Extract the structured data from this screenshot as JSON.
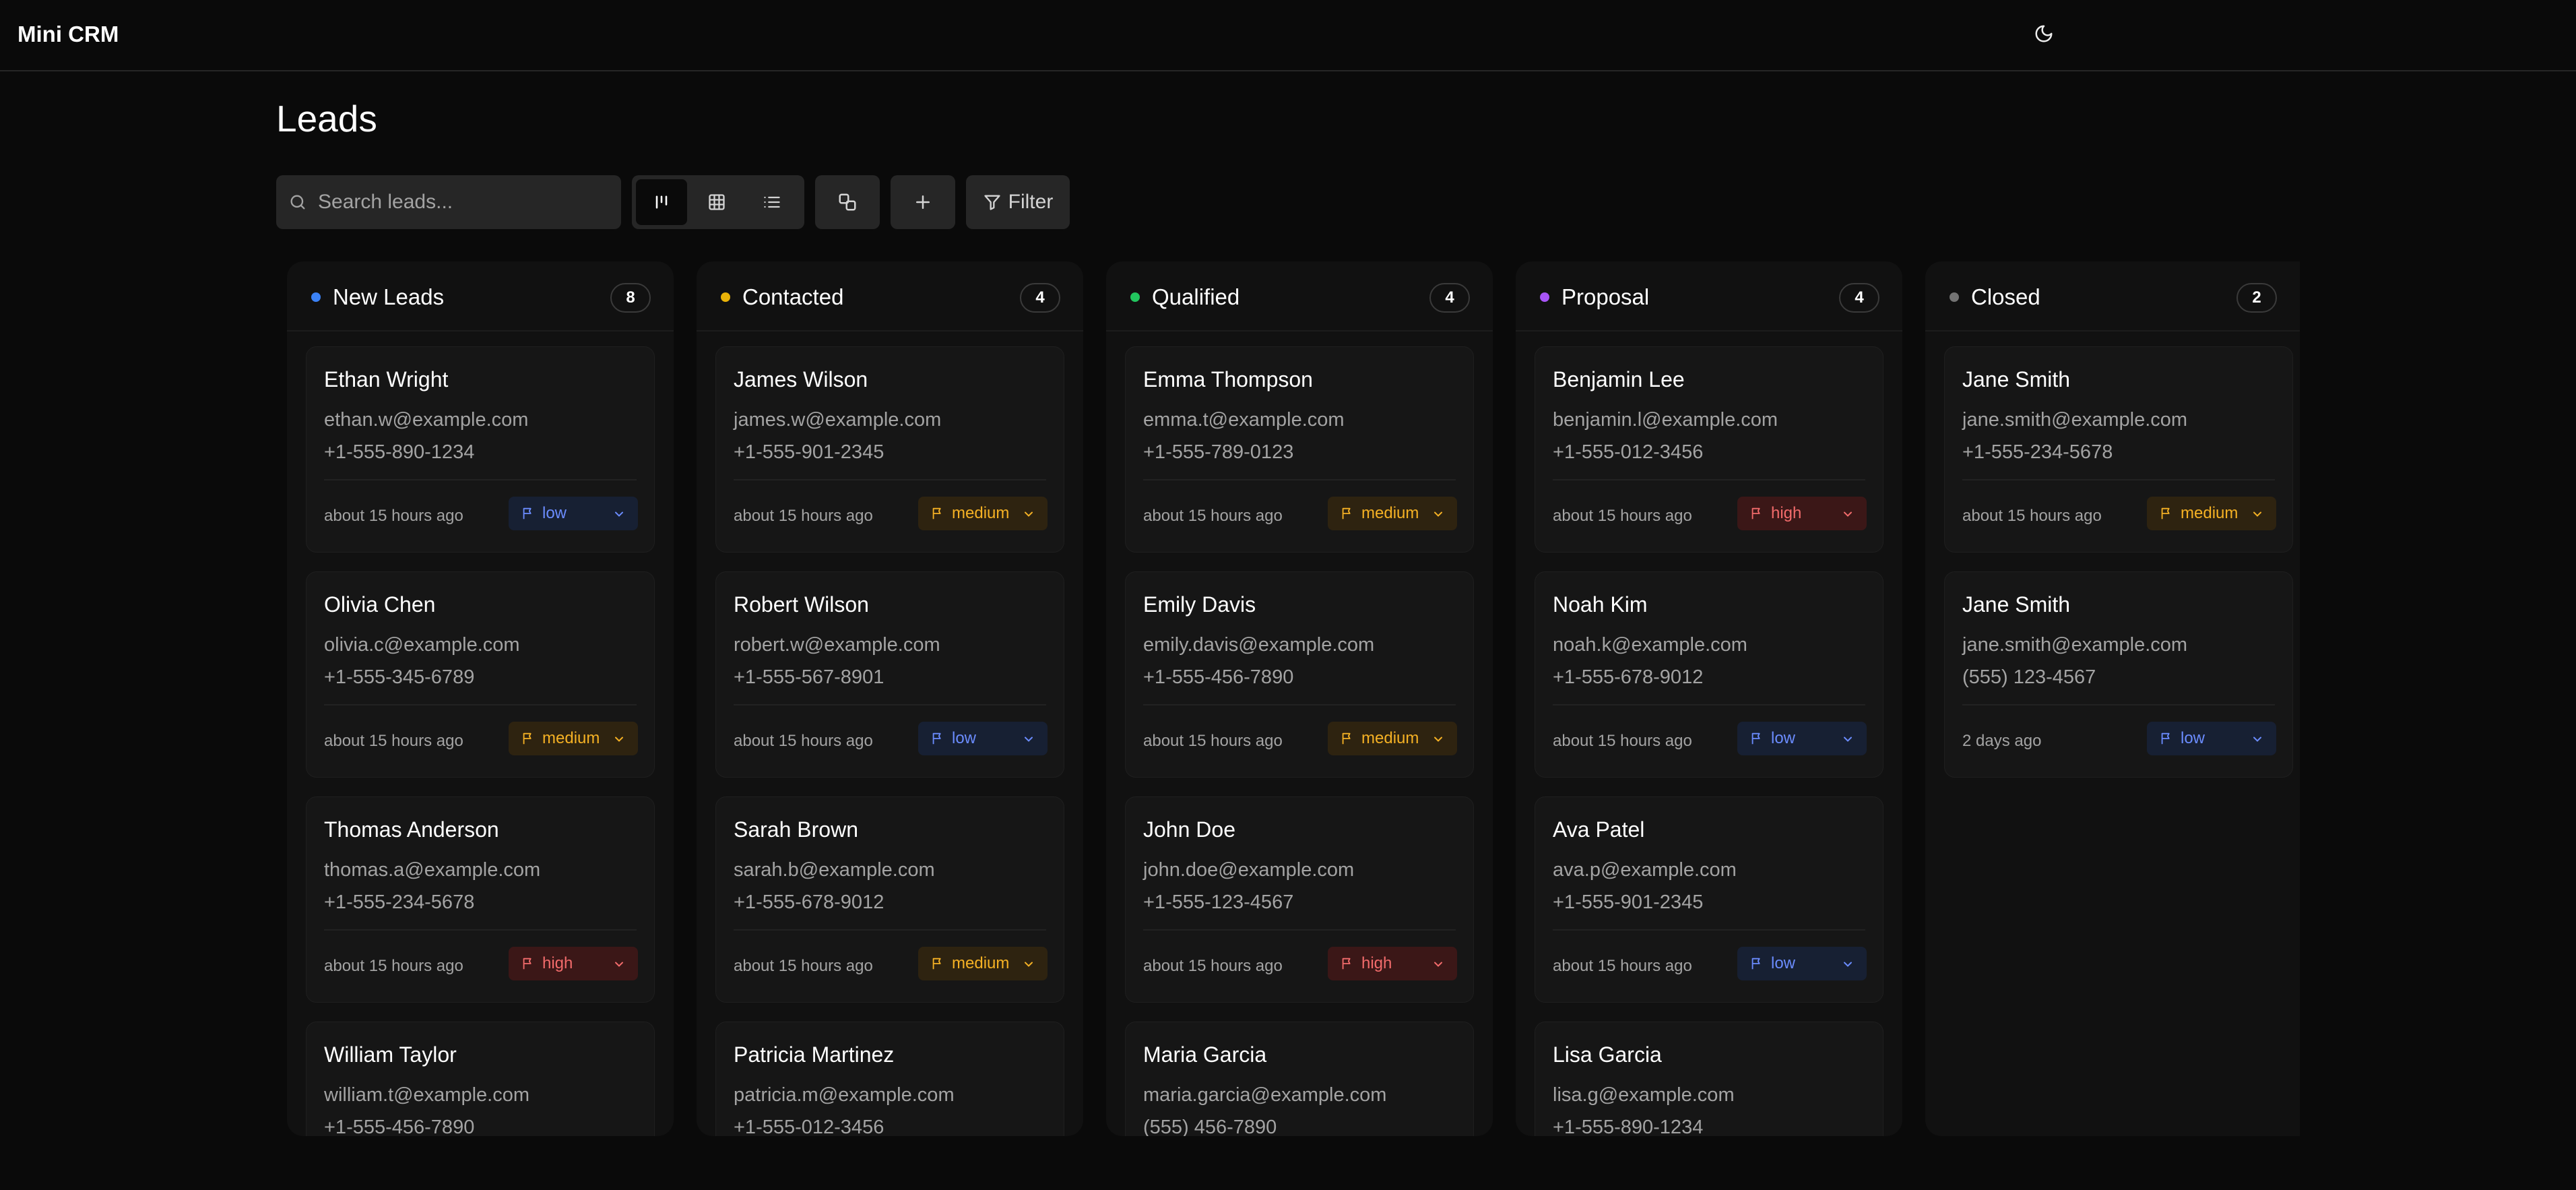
{
  "app": {
    "title": "Mini CRM"
  },
  "page": {
    "title": "Leads"
  },
  "search": {
    "placeholder": "Search leads..."
  },
  "toolbar": {
    "filter_label": "Filter"
  },
  "columns": [
    {
      "title": "New Leads",
      "count": "8",
      "color": "#3b82f6",
      "cards": [
        {
          "name": "Ethan Wright",
          "email": "ethan.w@example.com",
          "phone": "+1-555-890-1234",
          "time": "about 15 hours ago",
          "priority": "low"
        },
        {
          "name": "Olivia Chen",
          "email": "olivia.c@example.com",
          "phone": "+1-555-345-6789",
          "time": "about 15 hours ago",
          "priority": "medium"
        },
        {
          "name": "Thomas Anderson",
          "email": "thomas.a@example.com",
          "phone": "+1-555-234-5678",
          "time": "about 15 hours ago",
          "priority": "high"
        },
        {
          "name": "William Taylor",
          "email": "william.t@example.com",
          "phone": "+1-555-456-7890",
          "time": "",
          "priority": ""
        }
      ]
    },
    {
      "title": "Contacted",
      "count": "4",
      "color": "#eab308",
      "cards": [
        {
          "name": "James Wilson",
          "email": "james.w@example.com",
          "phone": "+1-555-901-2345",
          "time": "about 15 hours ago",
          "priority": "medium"
        },
        {
          "name": "Robert Wilson",
          "email": "robert.w@example.com",
          "phone": "+1-555-567-8901",
          "time": "about 15 hours ago",
          "priority": "low"
        },
        {
          "name": "Sarah Brown",
          "email": "sarah.b@example.com",
          "phone": "+1-555-678-9012",
          "time": "about 15 hours ago",
          "priority": "medium"
        },
        {
          "name": "Patricia Martinez",
          "email": "patricia.m@example.com",
          "phone": "+1-555-012-3456",
          "time": "",
          "priority": ""
        }
      ]
    },
    {
      "title": "Qualified",
      "count": "4",
      "color": "#22c55e",
      "cards": [
        {
          "name": "Emma Thompson",
          "email": "emma.t@example.com",
          "phone": "+1-555-789-0123",
          "time": "about 15 hours ago",
          "priority": "medium"
        },
        {
          "name": "Emily Davis",
          "email": "emily.davis@example.com",
          "phone": "+1-555-456-7890",
          "time": "about 15 hours ago",
          "priority": "medium"
        },
        {
          "name": "John Doe",
          "email": "john.doe@example.com",
          "phone": "+1-555-123-4567",
          "time": "about 15 hours ago",
          "priority": "high"
        },
        {
          "name": "Maria Garcia",
          "email": "maria.garcia@example.com",
          "phone": "(555) 456-7890",
          "time": "",
          "priority": ""
        }
      ]
    },
    {
      "title": "Proposal",
      "count": "4",
      "color": "#a855f7",
      "cards": [
        {
          "name": "Benjamin Lee",
          "email": "benjamin.l@example.com",
          "phone": "+1-555-012-3456",
          "time": "about 15 hours ago",
          "priority": "high"
        },
        {
          "name": "Noah Kim",
          "email": "noah.k@example.com",
          "phone": "+1-555-678-9012",
          "time": "about 15 hours ago",
          "priority": "low"
        },
        {
          "name": "Ava Patel",
          "email": "ava.p@example.com",
          "phone": "+1-555-901-2345",
          "time": "about 15 hours ago",
          "priority": "low"
        },
        {
          "name": "Lisa Garcia",
          "email": "lisa.g@example.com",
          "phone": "+1-555-890-1234",
          "time": "",
          "priority": ""
        }
      ]
    },
    {
      "title": "Closed",
      "count": "2",
      "color": "#737373",
      "cards": [
        {
          "name": "Jane Smith",
          "email": "jane.smith@example.com",
          "phone": "+1-555-234-5678",
          "time": "about 15 hours ago",
          "priority": "medium"
        },
        {
          "name": "Jane Smith",
          "email": "jane.smith@example.com",
          "phone": "(555) 123-4567",
          "time": "2 days ago",
          "priority": "low"
        }
      ]
    }
  ]
}
